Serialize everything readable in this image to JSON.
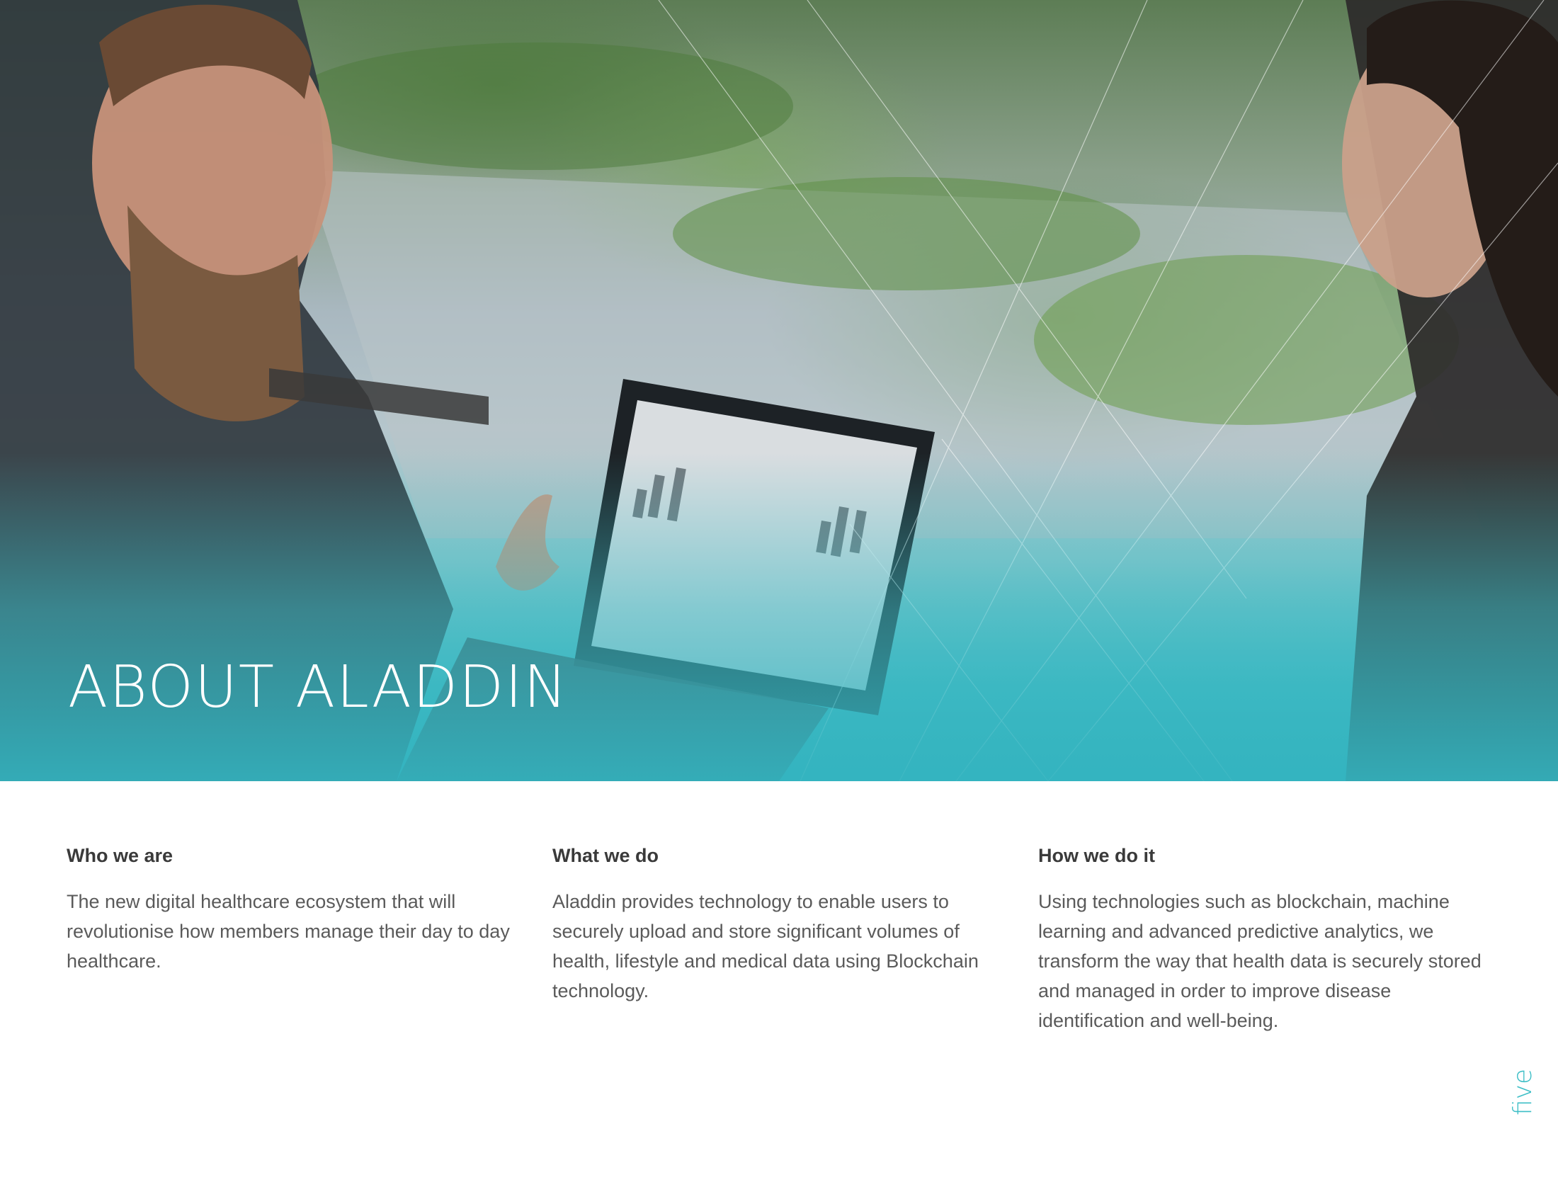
{
  "hero": {
    "title": "ABOUT ALADDIN",
    "image": "two-people-discussing-over-laptop-outdoors",
    "overlay_color": "#3bb8c2"
  },
  "columns": [
    {
      "heading": "Who we are",
      "body": "The new digital healthcare ecosystem that will revolutionise how members manage their day to day healthcare."
    },
    {
      "heading": "What we do",
      "body": "Aladdin provides technology to enable users to securely upload and store significant volumes of health, lifestyle and medical data using Blockchain technology."
    },
    {
      "heading": "How we do it",
      "body": "Using technologies such as blockchain, machine learning and advanced predictive analytics, we transform the way that health data is securely stored and managed in order to improve disease identification and well-being."
    }
  ],
  "page_number": "five",
  "colors": {
    "accent": "#3fbfc7",
    "heading_text": "#3a3a3a",
    "body_text": "#5a5a5a"
  }
}
